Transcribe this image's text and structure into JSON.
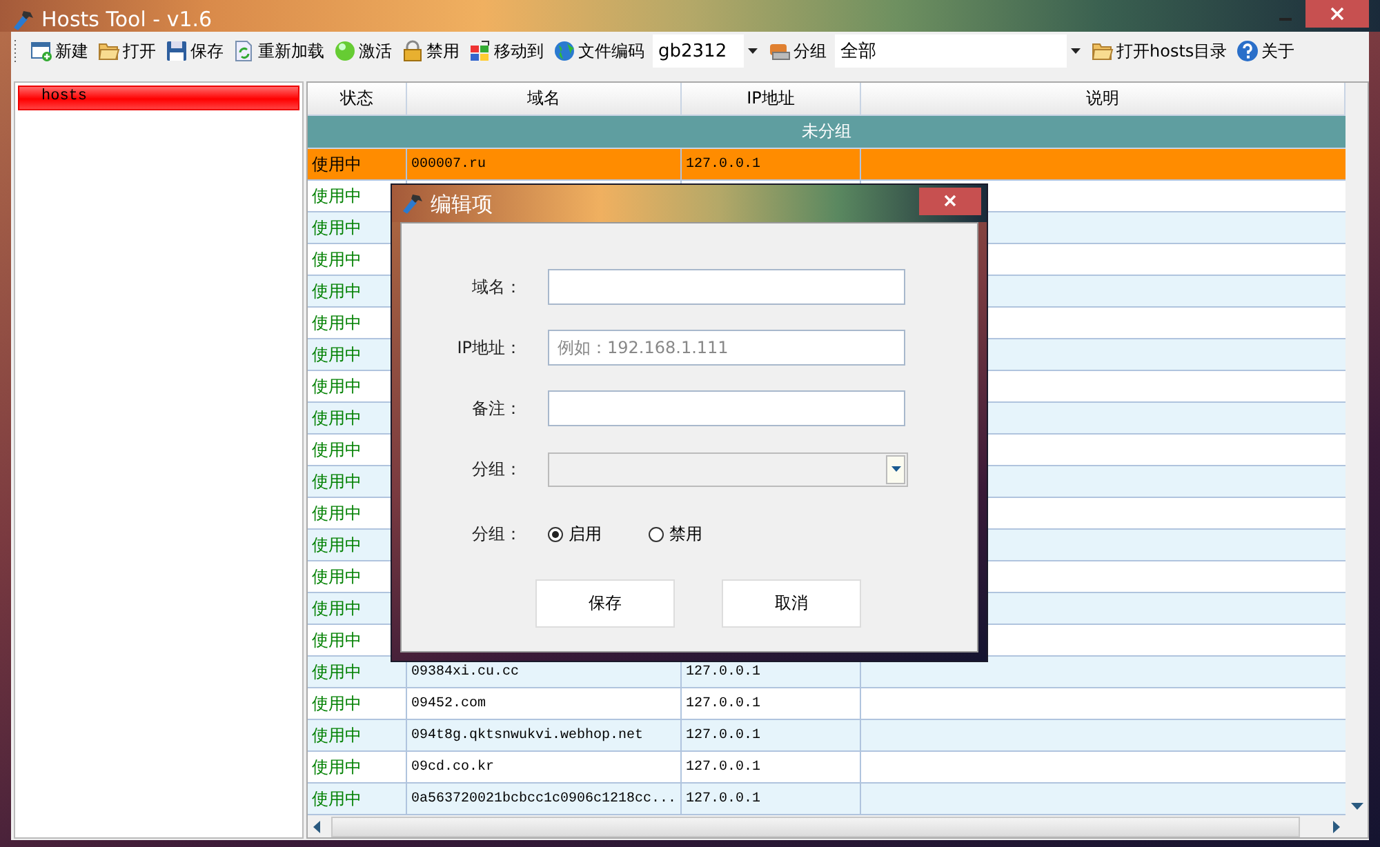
{
  "window": {
    "title": "Hosts Tool - v1.6"
  },
  "toolbar": {
    "items": [
      {
        "label": "新建"
      },
      {
        "label": "打开"
      },
      {
        "label": "保存"
      },
      {
        "label": "重新加载"
      },
      {
        "label": "激活"
      },
      {
        "label": "禁用"
      },
      {
        "label": "移动到"
      },
      {
        "label": "文件编码"
      }
    ],
    "encoding": {
      "value": "gb2312"
    },
    "group": {
      "label": "分组",
      "value": "全部"
    },
    "end_items": [
      {
        "label": "打开hosts目录"
      },
      {
        "label": "关于"
      }
    ]
  },
  "sidebar": {
    "items": [
      {
        "label": "hosts",
        "selected": true
      }
    ]
  },
  "table": {
    "columns": [
      "状态",
      "域名",
      "IP地址",
      "说明"
    ],
    "group_header": "未分组",
    "rows": [
      {
        "status": "使用中",
        "domain": "000007.ru",
        "ip": "127.0.0.1",
        "selected": true
      },
      {
        "status": "使用中",
        "selected": false
      },
      {
        "status": "使用中",
        "selected": false
      },
      {
        "status": "使用中",
        "selected": false
      },
      {
        "status": "使用中",
        "selected": false
      },
      {
        "status": "使用中",
        "selected": false
      },
      {
        "status": "使用中",
        "selected": false
      },
      {
        "status": "使用中",
        "selected": false
      },
      {
        "status": "使用中",
        "selected": false
      },
      {
        "status": "使用中",
        "selected": false
      },
      {
        "status": "使用中",
        "selected": false
      },
      {
        "status": "使用中",
        "selected": false
      },
      {
        "status": "使用中",
        "selected": false
      },
      {
        "status": "使用中",
        "selected": false
      },
      {
        "status": "使用中",
        "selected": false
      },
      {
        "status": "使用中",
        "selected": false
      },
      {
        "status": "使用中",
        "domain": "09384xi.cu.cc",
        "ip": "127.0.0.1",
        "selected": false
      },
      {
        "status": "使用中",
        "domain": "09452.com",
        "ip": "127.0.0.1",
        "selected": false
      },
      {
        "status": "使用中",
        "domain": "094t8g.qktsnwukvi.webhop.net",
        "ip": "127.0.0.1",
        "selected": false
      },
      {
        "status": "使用中",
        "domain": "09cd.co.kr",
        "ip": "127.0.0.1",
        "selected": false
      },
      {
        "status": "使用中",
        "domain": "0a563720021bcbcc1c0906c1218cc...",
        "ip": "127.0.0.1",
        "selected": false
      }
    ]
  },
  "dialog": {
    "title": "编辑项",
    "fields": [
      {
        "kind": "text",
        "label": "域名："
      },
      {
        "kind": "text",
        "label": "IP地址：",
        "placeholder": "例如：192.168.1.111"
      },
      {
        "kind": "text",
        "label": "备注："
      },
      {
        "kind": "select",
        "label": "分组："
      }
    ],
    "radio": {
      "label": "分组：",
      "options": [
        {
          "label": "启用",
          "selected": true
        },
        {
          "label": "禁用",
          "selected": false
        }
      ]
    },
    "buttons": [
      "保存",
      "取消"
    ]
  }
}
